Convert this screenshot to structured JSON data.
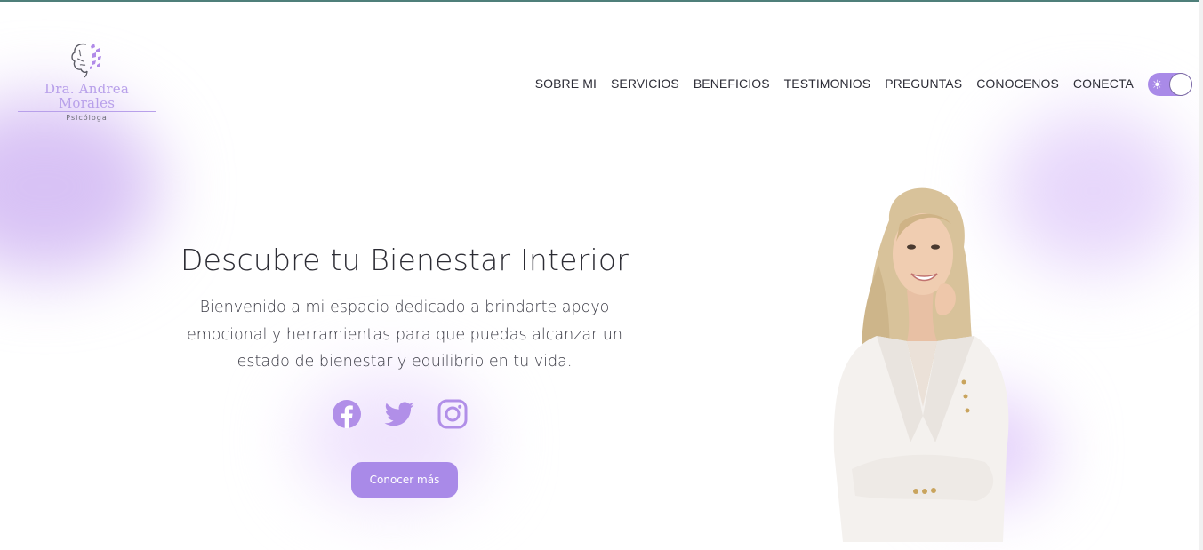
{
  "brand": {
    "name": "Dra. Andrea Morales",
    "subtitle": "Psicóloga",
    "logo_icon": "brain-butterflies-icon",
    "accent_color": "#a98ae8"
  },
  "nav": {
    "items": [
      "SOBRE MI",
      "SERVICIOS",
      "BENEFICIOS",
      "TESTIMONIOS",
      "PREGUNTAS",
      "CONOCENOS",
      "CONECTA"
    ],
    "theme_toggle": {
      "icon": "sun-icon",
      "state": "light"
    }
  },
  "hero": {
    "title": "Descubre tu Bienestar Interior",
    "text_lines": [
      "Bienvenido a mi espacio dedicado a brindarte apoyo",
      "emocional y herramientas para que puedas alcanzar un",
      "estado de bienestar y equilibrio en tu vida."
    ],
    "social": [
      "facebook-icon",
      "twitter-icon",
      "instagram-icon"
    ],
    "cta_label": "Conocer más",
    "portrait": "portrait-photo"
  }
}
